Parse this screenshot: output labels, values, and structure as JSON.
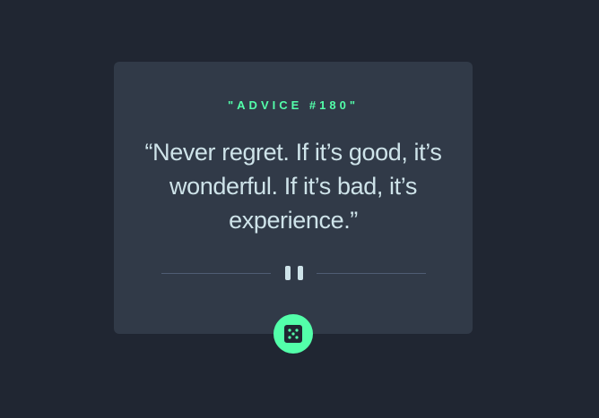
{
  "card": {
    "advice_id": "\"ADVICE #180\"",
    "quote": "“Never regret. If it’s good, it’s wonderful. If it’s bad, it’s experience.”"
  },
  "divider": {
    "icon": "pause-icon"
  },
  "dice_button": {
    "icon": "dice-icon"
  },
  "colors": {
    "background": "#202632",
    "card": "#313a48",
    "accent": "#53ffaa",
    "text": "#cee3e9",
    "divider_line": "#4f5d74"
  }
}
